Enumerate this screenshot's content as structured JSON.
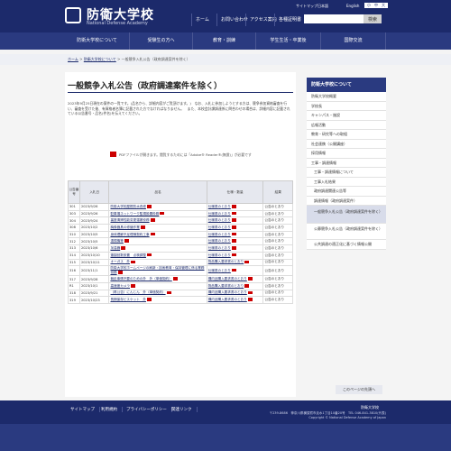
{
  "header": {
    "logo_jp": "防衛大学校",
    "logo_en": "National Defense Academy",
    "util": {
      "sitemap": "サイトマップ",
      "japanese": "日本語",
      "english": "English",
      "font_small": "小",
      "font_medium": "中",
      "font_large": "大"
    },
    "nav": [
      "ホーム",
      "お問い合わせ",
      "アクセス案内",
      "各種証明書"
    ],
    "search_placeholder": "",
    "search_button": "検索"
  },
  "global_nav": [
    "防衛大学校について",
    "受験生の方へ",
    "教育・訓練",
    "学生生活・卒業後",
    "国際交流"
  ],
  "breadcrumb": {
    "home": "ホーム",
    "about": "防衛大学校について",
    "current": "一般競争入札公告（政府調達案件を除く）",
    "sep": ">"
  },
  "main": {
    "title": "一般競争入札公告（政府調達案件を除く）",
    "intro": "2023年9月25日現在の案件の一覧です。(品名から、詳細内容がご覧頂けます。)　なお、入札に参加しようとする方は、競争参加資格審査を行い、審査を受けた後、有資格者名簿に記載された方でなければなりません。　また、本校会計課調達係に問合わせの場合は、詳細内容に記載されている公告番号・品名(件名)を伝えてください。",
    "pdf_note": "PDFファイルが開きます。閲覧するためには「Adobe® Reader®(無償)」が必要です"
  },
  "table": {
    "headers": [
      "公告番号",
      "入札日",
      "品名",
      "仕様・数量",
      "結果"
    ],
    "rows": [
      [
        "301",
        "2023/9/26",
        "防衛大学校屋根防水改修",
        "仕様書のとおり",
        "公告のとおり"
      ],
      [
        "303",
        "2023/9/26",
        "駐車場ネットワーク監視設置役務",
        "仕様書のとおり",
        "公告のとおり"
      ],
      [
        "304",
        "2023/9/24",
        "裏庭清掃性能変更運搬役務",
        "仕様書のとおり",
        "公告のとおり"
      ],
      [
        "308",
        "2023/10/2",
        "胸像器具の修繕作業",
        "仕様書のとおり",
        "公告のとおり"
      ],
      [
        "310",
        "2023/10/5",
        "身体理解不足理様契約工事",
        "仕様書のとおり",
        "公告のとおり"
      ],
      [
        "312",
        "2023/10/5",
        "遠視機等",
        "仕様書のとおり",
        "公告のとおり"
      ],
      [
        "313",
        "2023/10/6",
        "加温器",
        "仕様書のとおり",
        "公告のとおり"
      ],
      [
        "314",
        "2023/10/10",
        "蓮園回数設置　点検調整",
        "仕様書のとおり",
        "公告のとおり"
      ],
      [
        "315",
        "2023/10/11",
        "オーガス　外",
        "物品購入要求書のとおり",
        "公告のとおり"
      ],
      [
        "316",
        "2023/11/1",
        "防衛大学校ホームページの刷新・技術教育・保持管理に係る業務役務",
        "仕様書のとおり",
        "公告のとおり"
      ],
      [
        "317",
        "2023/9/28",
        "競走事情不要のための外　外（単価契約）",
        "構内品購入要求書のとおり",
        "公告のとおり"
      ],
      [
        "R1",
        "2023/10/1",
        "高速度カメラ",
        "物品購入要求書のとおり",
        "公告のとおり"
      ],
      [
        "318",
        "2023/9/21",
        "（再公告）にんじん　外（単価契約）",
        "構内品購入要求書のとおり",
        "公告のとおり"
      ],
      [
        "319",
        "2023/10/23",
        "長期保存ビスケット　外",
        "構内品購入要求書のとおり",
        "公告のとおり"
      ]
    ]
  },
  "next_page": "このページの先頭へ",
  "sidebar": {
    "head": "防衛大学校について",
    "items": [
      "防衛大学校概要",
      "学校長",
      "キャンパス・施設",
      "広報活動",
      "教育・研究等への取組",
      "社会連携（公開講座）",
      "採用情報",
      "工事・調達情報",
      "工事・調達情報について",
      "工事入札結果",
      "政府調達関連公告等",
      "調達情報（政府調達案件）",
      "一般競争入札公告（政府調達案件を除く）",
      "公募競争入札公告（政府調達案件を除く）",
      "公共調達の適正化に基づく情報公開"
    ]
  },
  "footer": {
    "nav": [
      "サイトマップ",
      "利用規約",
      "プライバシーポリシー",
      "関連リンク"
    ],
    "org": "防衛大学校",
    "address": "〒239-8686　神奈川県横須賀市走水1丁目10番20号　TEL 046-841-3810(代表)",
    "copyright": "Copyright © National Defense Academy of Japan"
  }
}
